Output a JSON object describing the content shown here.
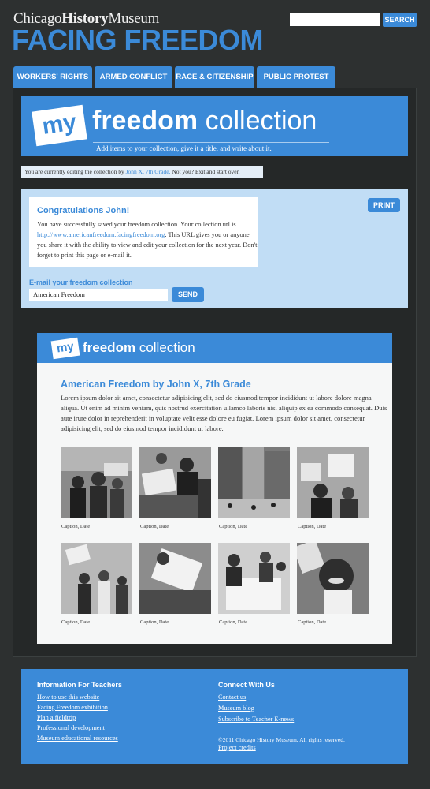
{
  "header": {
    "brand_prefix": "Chicago",
    "brand_bold": "History",
    "brand_suffix": "Museum",
    "site_title": "FACING FREEDOM",
    "search_placeholder": "",
    "search_label": "SEARCH"
  },
  "tabs": [
    {
      "label": "WORKERS' RIGHTS"
    },
    {
      "label": "ARMED CONFLICT"
    },
    {
      "label": "RACE & CITIZENSHIP"
    },
    {
      "label": "PUBLIC PROTEST"
    }
  ],
  "banner": {
    "logo": "my",
    "title_bold": "freedom",
    "title_light": "collection",
    "subtitle": "Add items to your collection, give it a title, and write about it."
  },
  "editing_notice": {
    "prefix": "You are currently editing the collection by",
    "name": "John X, 7th Grade.",
    "suffix": "Not you? Exit and start over."
  },
  "save_panel": {
    "title": "Congratulations John!",
    "body_before": "You have successfully saved your freedom collection. Your collection url is",
    "url": "http://www.americanfreedom.facingfreedom.org",
    "body_after": ". This URL gives you or anyone you share it with the ability to view and edit your collection for the next year. Don't forget to print this page or e-mail it.",
    "print_label": "PRINT",
    "email_label": "E-mail your freedom collection",
    "email_value": "American Freedom",
    "send_label": "SEND"
  },
  "preview": {
    "logo": "my",
    "title_bold": "freedom",
    "title_light": "collection",
    "collection_title": "American Freedom by John X, 7th Grade",
    "body": "Lorem ipsum dolor sit amet, consectetur adipisicing elit, sed do eiusmod tempor incididunt ut labore dolore magna aliqua. Ut enim ad minim veniam, quis nostrud exercitation ullamco laboris nisi aliquip ex ea commodo consequat. Duis aute irure dolor in reprehenderit in voluptate velit esse dolore eu fugiat. Lorem ipsum dolor sit amet, consectetur adipisicing elit, sed do eiusmod tempor incididunt ut labore.",
    "photos": [
      {
        "caption": "Caption, Date"
      },
      {
        "caption": "Caption, Date"
      },
      {
        "caption": "Caption, Date"
      },
      {
        "caption": "Caption, Date"
      },
      {
        "caption": "Caption, Date"
      },
      {
        "caption": "Caption, Date"
      },
      {
        "caption": "Caption, Date"
      },
      {
        "caption": "Caption, Date"
      }
    ]
  },
  "footer": {
    "teachers_heading": "Information For Teachers",
    "teachers_links": [
      "How to use this website",
      "Facing Freedom exhibition",
      "Plan a fieldtrip",
      "Professional development",
      "Museum educational resources"
    ],
    "connect_heading": "Connect With Us",
    "connect_links": [
      "Contact us",
      "Museum blog",
      "Subscribe to Teacher E-news"
    ],
    "copyright": "©2011 Chicago History Museum, All rights reserved.",
    "credits": "Project credits"
  },
  "colors": {
    "accent": "#3b8ad8",
    "background": "#2d3030",
    "light_panel": "#c1ddf5"
  }
}
